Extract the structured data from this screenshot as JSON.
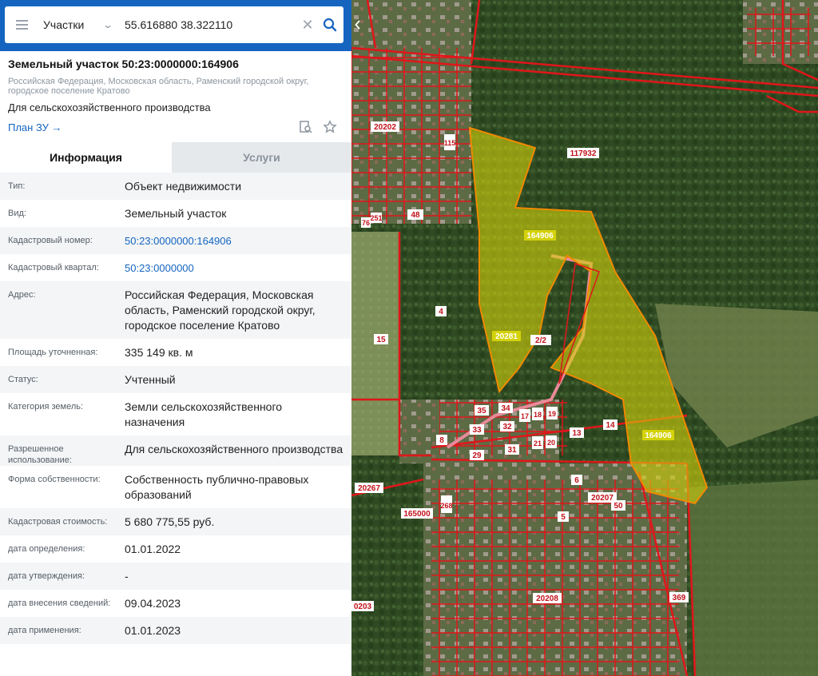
{
  "search": {
    "layer": "Участки",
    "query": "55.616880 38.322110"
  },
  "header": {
    "title": "Земельный участок 50:23:0000000:164906",
    "address": "Российская Федерация, Московская область, Раменский городской округ, городское поселение Кратово",
    "purpose": "Для сельскохозяйственного производства",
    "plan_link": "План ЗУ →"
  },
  "tabs": [
    {
      "label": "Информация"
    },
    {
      "label": "Услуги"
    }
  ],
  "info": [
    {
      "label": "Тип:",
      "value": "Объект недвижимости"
    },
    {
      "label": "Вид:",
      "value": "Земельный участок"
    },
    {
      "label": "Кадастровый номер:",
      "value": "50:23:0000000:164906"
    },
    {
      "label": "Кадастровый квартал:",
      "value": "50:23:0000000"
    },
    {
      "label": "Адрес:",
      "value": "Российская Федерация, Московская область, Раменский городской округ, городское поселение Кратово"
    },
    {
      "label": "Площадь уточненная:",
      "value": "335 149 кв. м"
    },
    {
      "label": "Статус:",
      "value": "Учтенный"
    },
    {
      "label": "Категория земель:",
      "value": "Земли сельскохозяйственного назначения"
    },
    {
      "label": "Разрешенное использование:",
      "value": "Для сельскохозяйственного производства"
    },
    {
      "label": "Форма собственности:",
      "value": "Собственность публично-правовых образований"
    },
    {
      "label": "Кадастровая стоимость:",
      "value": "5 680 775,55 руб."
    },
    {
      "label": "дата определения:",
      "value": "01.01.2022"
    },
    {
      "label": "дата утверждения:",
      "value": "-"
    },
    {
      "label": "дата внесения сведений:",
      "value": "09.04.2023"
    },
    {
      "label": "дата применения:",
      "value": "01.01.2023"
    }
  ],
  "map": {
    "labels": [
      "117932",
      "20202",
      "115",
      "164906",
      "48",
      "251",
      "76",
      "20281",
      "2/2",
      "4",
      "15",
      "35",
      "34",
      "33",
      "32",
      "8",
      "29",
      "31",
      "20",
      "21",
      "17",
      "18",
      "19",
      "13",
      "14",
      "164906",
      "20267",
      "165000",
      "268",
      "6",
      "20207",
      "50",
      "5",
      "20208",
      "369",
      "0203"
    ]
  },
  "colors": {
    "accent": "#1565c0",
    "parcel_outline": "#e0161a",
    "selected_fill": "#d4d20a",
    "selected_stroke": "#f08a00"
  }
}
